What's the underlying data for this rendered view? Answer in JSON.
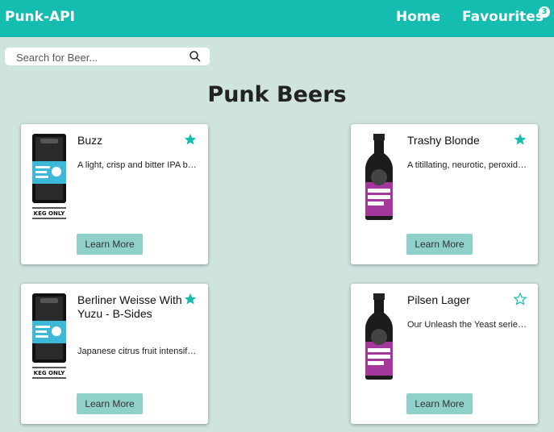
{
  "header": {
    "brand": "Punk-API",
    "nav_home": "Home",
    "nav_favourites": "Favourites",
    "favourites_count": "3"
  },
  "search": {
    "placeholder": "Search for Beer...",
    "value": ""
  },
  "page": {
    "title": "Punk Beers"
  },
  "beers": [
    {
      "name": "Buzz",
      "description": "A light, crisp and bitter IPA brewed with English and American hops.",
      "favourite": true,
      "image": "keg-only-can-icon"
    },
    {
      "name": "Trashy Blonde",
      "description": "A titillating, neurotic, peroxide punk of a Pale Ale.",
      "favourite": true,
      "image": "purple-bottle-icon"
    },
    {
      "name": "Berliner Weisse With Yuzu - B-Sides",
      "description": "Japanese citrus fruit intensifies the sour nature of this German classic.",
      "favourite": true,
      "image": "keg-only-can-icon"
    },
    {
      "name": "Pilsen Lager",
      "description": "Our Unleash the Yeast series was an epic experiment into the differences in aroma and flavour provided by switching up your yeast.",
      "favourite": false,
      "image": "purple-bottle-icon"
    }
  ],
  "card_button_label": "Learn More",
  "colors": {
    "header": "#14bdb0",
    "background": "#cfe3df",
    "button": "#8fd0c9",
    "star": "#14bdb0"
  }
}
